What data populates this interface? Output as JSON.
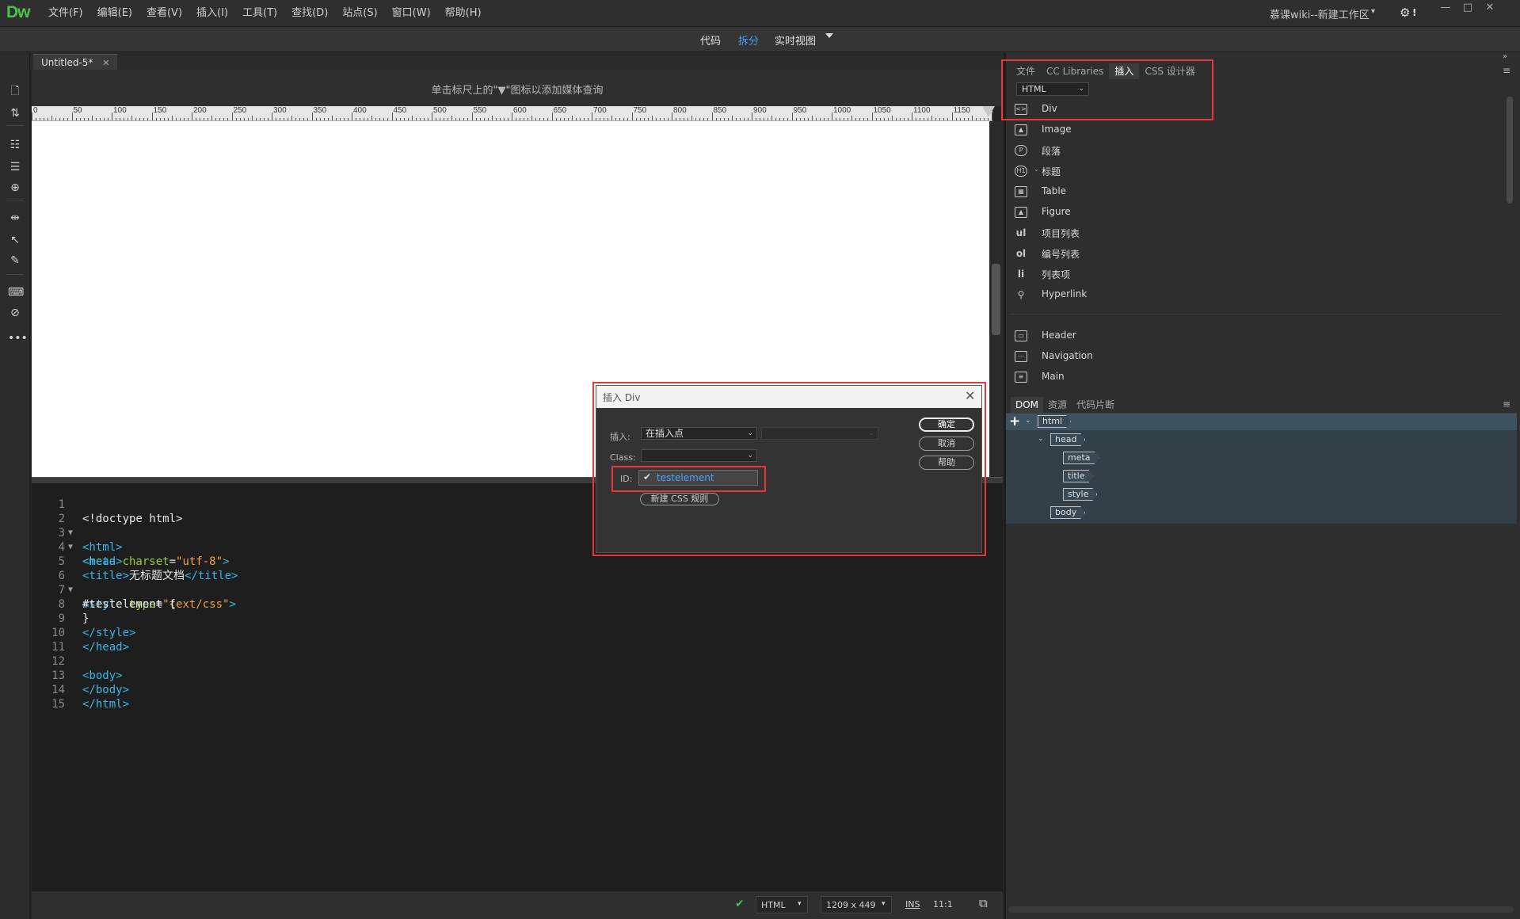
{
  "app": {
    "logo": "Dw",
    "menu": [
      "文件(F)",
      "编辑(E)",
      "查看(V)",
      "插入(I)",
      "工具(T)",
      "查找(D)",
      "站点(S)",
      "窗口(W)",
      "帮助(H)"
    ],
    "workspace": "慕课wiki--新建工作区"
  },
  "views": {
    "code": "代码",
    "split": "拆分",
    "live": "实时视图",
    "active": "拆分"
  },
  "document": {
    "tab_title": "Untitled-5*",
    "media_hint": "单击标尺上的\"▼\"图标以添加媒体查询",
    "ruler_labels": [
      "0",
      "50",
      "100",
      "150",
      "200",
      "250",
      "300",
      "350",
      "400",
      "450",
      "500",
      "550",
      "600",
      "650",
      "700",
      "750",
      "800",
      "850",
      "900",
      "950",
      "1000",
      "1050",
      "1100",
      "1150"
    ]
  },
  "code": {
    "line_numbers": [
      "1",
      "2",
      "3",
      "4",
      "5",
      "6",
      "7",
      "8",
      "9",
      "10",
      "11",
      "12",
      "13",
      "14",
      "15"
    ],
    "lines": {
      "l1": "<!doctype html>",
      "l2": "<html>",
      "l3": "<head>",
      "l4_open": "<meta ",
      "l4_attr": "charset",
      "l4_eq": "=",
      "l4_val": "\"utf-8\"",
      "l4_close": ">",
      "l5_open": "<title>",
      "l5_text": "无标题文档",
      "l5_close": "</title>",
      "l6_open": "<style ",
      "l6_attr": "type",
      "l6_eq": "=",
      "l6_val": "\"text/css\"",
      "l6_close": ">",
      "l7": "#testelement {",
      "l8": "}",
      "l9": "</style>",
      "l10": "</head>",
      "l11": "",
      "l12": "<body>",
      "l13": "</body>",
      "l14": "</html>",
      "l15": ""
    }
  },
  "status": {
    "language": "HTML",
    "size": "1209 x 449",
    "mode": "INS",
    "position": "11:1"
  },
  "insert_panel": {
    "tabs": [
      "文件",
      "CC Libraries",
      "插入",
      "CSS 设计器"
    ],
    "active_tab": "插入",
    "category": "HTML",
    "items": [
      {
        "label": "Div",
        "icon": "<>"
      },
      {
        "label": "Image",
        "icon": "img"
      },
      {
        "label": "段落",
        "icon": "P"
      },
      {
        "label": "标题",
        "icon": "H1"
      },
      {
        "label": "Table",
        "icon": "tbl"
      },
      {
        "label": "Figure",
        "icon": "fig"
      },
      {
        "label": "项目列表",
        "icon": "ul"
      },
      {
        "label": "编号列表",
        "icon": "ol"
      },
      {
        "label": "列表项",
        "icon": "li"
      },
      {
        "label": "Hyperlink",
        "icon": "link"
      },
      {
        "label": "Header",
        "icon": "hdr"
      },
      {
        "label": "Navigation",
        "icon": "nav"
      },
      {
        "label": "Main",
        "icon": "main"
      }
    ]
  },
  "dom_panel": {
    "tabs": [
      "DOM",
      "资源",
      "代码片断"
    ],
    "active_tab": "DOM",
    "nodes": [
      "html",
      "head",
      "meta",
      "title",
      "style",
      "body"
    ]
  },
  "dialog": {
    "title": "插入 Div",
    "insert_label": "插入:",
    "insert_value": "在插入点",
    "class_label": "Class:",
    "class_value": "",
    "id_label": "ID:",
    "id_suggestion": "testelement",
    "new_css_button": "新建 CSS 规则",
    "ok_button": "确定",
    "cancel_button": "取消",
    "help_button": "帮助"
  },
  "colors": {
    "accent": "#3fa0ff",
    "highlight_box": "#e23a3a",
    "logo": "#4cc24c",
    "code_tag": "#3ab7e8",
    "code_attr": "#9ccc3c",
    "code_string": "#f0a040"
  }
}
